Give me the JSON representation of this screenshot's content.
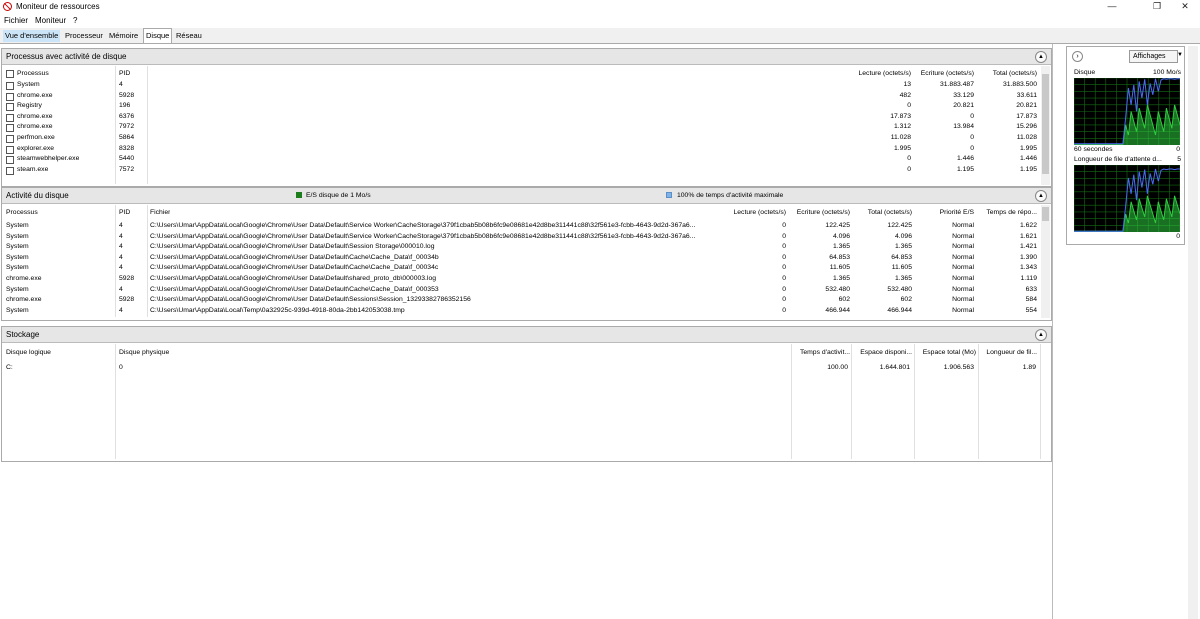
{
  "window": {
    "title": "Moniteur de ressources",
    "minimize": "—",
    "maximize": "❐",
    "close": "✕"
  },
  "menu": [
    "Fichier",
    "Moniteur",
    "?"
  ],
  "tabs": [
    "Vue d'ensemble",
    "Processeur",
    "Mémoire",
    "Disque",
    "Réseau"
  ],
  "process_panel": {
    "title": "Processus avec activité de disque",
    "columns": [
      "Processus",
      "PID",
      "Lecture (octets/s)",
      "Écriture (octets/s)",
      "Total (octets/s)"
    ],
    "rows": [
      [
        "System",
        "4",
        "13",
        "31.883.487",
        "31.883.500"
      ],
      [
        "chrome.exe",
        "5928",
        "482",
        "33.129",
        "33.611"
      ],
      [
        "Registry",
        "196",
        "0",
        "20.821",
        "20.821"
      ],
      [
        "chrome.exe",
        "6376",
        "17.873",
        "0",
        "17.873"
      ],
      [
        "chrome.exe",
        "7972",
        "1.312",
        "13.984",
        "15.296"
      ],
      [
        "perfmon.exe",
        "5864",
        "11.028",
        "0",
        "11.028"
      ],
      [
        "explorer.exe",
        "8328",
        "1.995",
        "0",
        "1.995"
      ],
      [
        "steamwebhelper.exe",
        "5440",
        "0",
        "1.446",
        "1.446"
      ],
      [
        "steam.exe",
        "7572",
        "0",
        "1.195",
        "1.195"
      ]
    ]
  },
  "activity_panel": {
    "title": "Activité du disque",
    "legend_io": "E/S disque de 1 Mo/s",
    "legend_active": "100% de temps d'activité maximale",
    "columns": [
      "Processus",
      "PID",
      "Fichier",
      "Lecture (octets/s)",
      "Écriture (octets/s)",
      "Total (octets/s)",
      "Priorité E/S",
      "Temps de répo..."
    ],
    "rows": [
      [
        "System",
        "4",
        "C:\\Users\\Umar\\AppData\\Local\\Google\\Chrome\\User Data\\Default\\Service Worker\\CacheStorage\\379f1cbab5b08b6fc9e08681e42d8be311441c88\\32f561e3-fcbb-4643-9d2d-367a6...",
        "0",
        "122.425",
        "122.425",
        "Normal",
        "1.622"
      ],
      [
        "System",
        "4",
        "C:\\Users\\Umar\\AppData\\Local\\Google\\Chrome\\User Data\\Default\\Service Worker\\CacheStorage\\379f1cbab5b08b6fc9e08681e42d8be311441c88\\32f561e3-fcbb-4643-9d2d-367a6...",
        "0",
        "4.096",
        "4.096",
        "Normal",
        "1.621"
      ],
      [
        "System",
        "4",
        "C:\\Users\\Umar\\AppData\\Local\\Google\\Chrome\\User Data\\Default\\Session Storage\\000010.log",
        "0",
        "1.365",
        "1.365",
        "Normal",
        "1.421"
      ],
      [
        "System",
        "4",
        "C:\\Users\\Umar\\AppData\\Local\\Google\\Chrome\\User Data\\Default\\Cache\\Cache_Data\\f_00034b",
        "0",
        "64.853",
        "64.853",
        "Normal",
        "1.390"
      ],
      [
        "System",
        "4",
        "C:\\Users\\Umar\\AppData\\Local\\Google\\Chrome\\User Data\\Default\\Cache\\Cache_Data\\f_00034c",
        "0",
        "11.605",
        "11.605",
        "Normal",
        "1.343"
      ],
      [
        "chrome.exe",
        "5928",
        "C:\\Users\\Umar\\AppData\\Local\\Google\\Chrome\\User Data\\Default\\shared_proto_db\\000003.log",
        "0",
        "1.365",
        "1.365",
        "Normal",
        "1.119"
      ],
      [
        "System",
        "4",
        "C:\\Users\\Umar\\AppData\\Local\\Google\\Chrome\\User Data\\Default\\Cache\\Cache_Data\\f_000353",
        "0",
        "532.480",
        "532.480",
        "Normal",
        "633"
      ],
      [
        "chrome.exe",
        "5928",
        "C:\\Users\\Umar\\AppData\\Local\\Google\\Chrome\\User Data\\Default\\Sessions\\Session_13293382786352156",
        "0",
        "602",
        "602",
        "Normal",
        "584"
      ],
      [
        "System",
        "4",
        "C:\\Users\\Umar\\AppData\\Local\\Temp\\0a32925c-939d-4918-80da-2bb142053038.tmp",
        "0",
        "466.944",
        "466.944",
        "Normal",
        "554"
      ]
    ]
  },
  "storage_panel": {
    "title": "Stockage",
    "columns": [
      "Disque logique",
      "Disque physique",
      "Temps d'activit...",
      "Espace disponi...",
      "Espace total (Mo)",
      "Longueur de fil..."
    ],
    "rows": [
      [
        "C:",
        "0",
        "100.00",
        "1.644.801",
        "1.906.563",
        "1.89"
      ]
    ]
  },
  "sidebar": {
    "views_button": "Affichages",
    "disk_label": "Disque",
    "disk_scale": "100 Mo/s",
    "time_label": "60 secondes",
    "time_value": "0",
    "queue_label": "Longueur de file d'attente d...",
    "queue_scale": "5",
    "queue_value": "0"
  },
  "colors": {
    "graph_bg": "#000000",
    "graph_line_green": "#2ecc40",
    "graph_line_blue": "#4a6cf7",
    "legend_green": "#1b7d1b",
    "legend_blue": "#7fb3e8"
  }
}
